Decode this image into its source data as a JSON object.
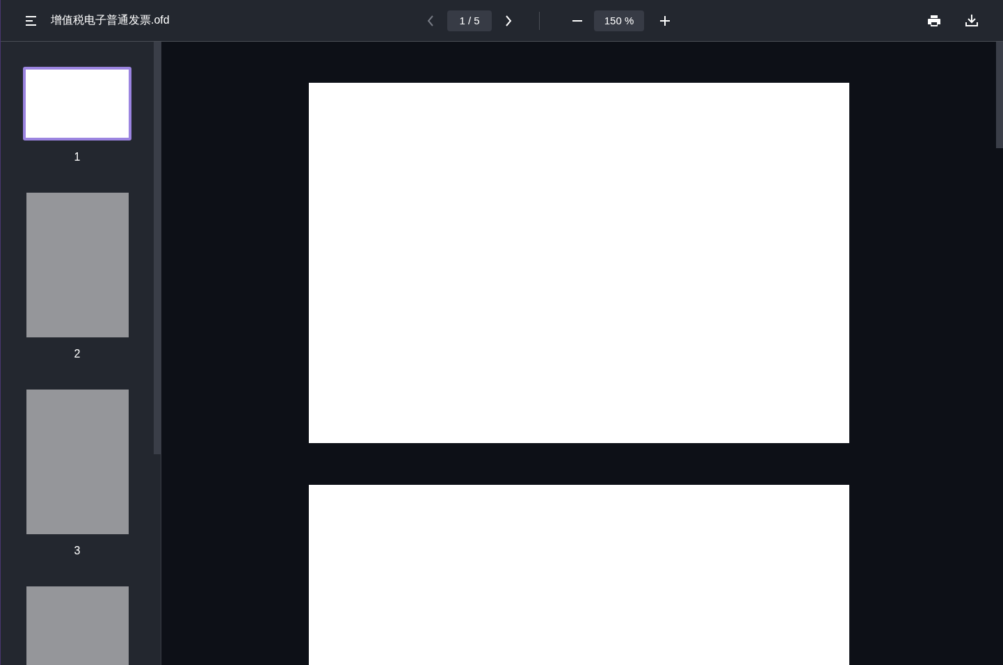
{
  "file_name": "增值税电子普通发票.ofd",
  "pager": {
    "current": "1 / 5",
    "prev_disabled": true,
    "next_disabled": false
  },
  "zoom": "150 %",
  "thumbnails": [
    {
      "label": "1",
      "selected": true,
      "loaded": true
    },
    {
      "label": "2",
      "selected": false,
      "loaded": false
    },
    {
      "label": "3",
      "selected": false,
      "loaded": false
    },
    {
      "selected": false,
      "loaded": false
    }
  ]
}
